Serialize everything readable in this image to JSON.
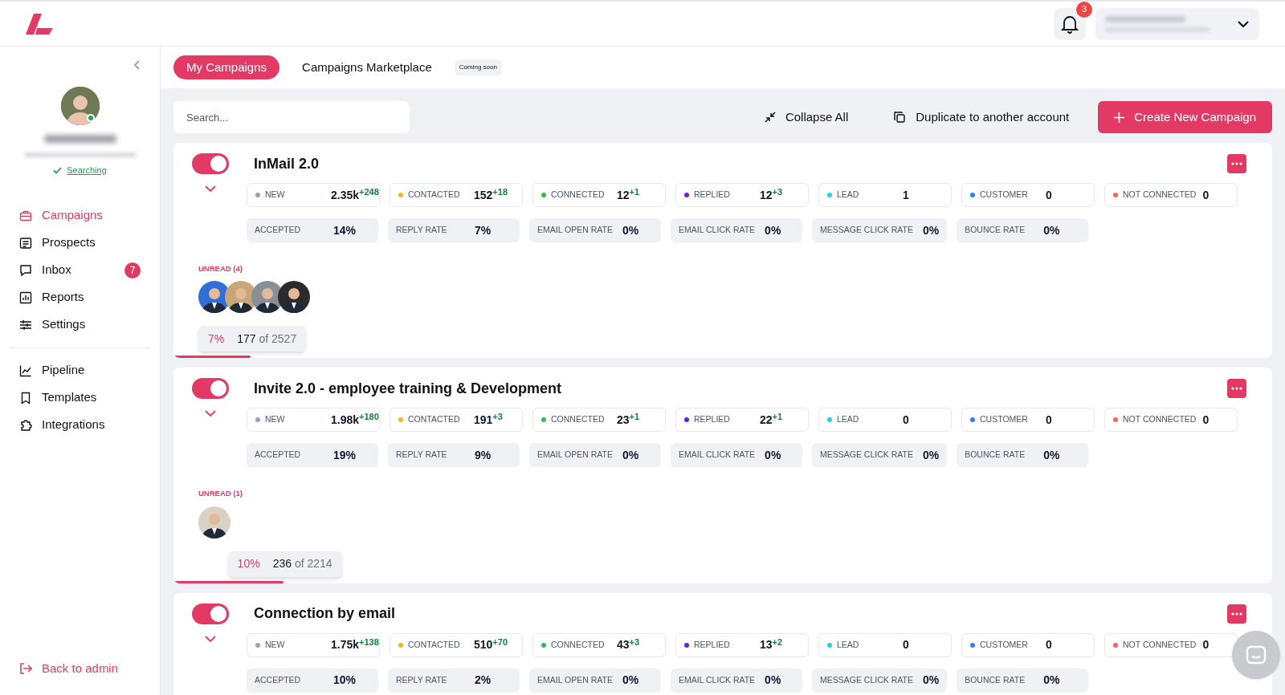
{
  "header": {
    "notifications": {
      "count": "3"
    }
  },
  "sidebar": {
    "status": "Searching",
    "nav": [
      {
        "label": "Campaigns",
        "kind": "briefcase",
        "selected": true
      },
      {
        "label": "Prospects",
        "kind": "list",
        "selected": false
      },
      {
        "label": "Inbox",
        "kind": "chat",
        "selected": false,
        "badge": "7"
      },
      {
        "label": "Reports",
        "kind": "chart",
        "selected": false
      },
      {
        "label": "Settings",
        "kind": "sliders",
        "selected": false
      }
    ],
    "secondary_nav": [
      {
        "label": "Pipeline",
        "kind": "trend",
        "selected": false
      },
      {
        "label": "Templates",
        "kind": "bookmark",
        "selected": false
      },
      {
        "label": "Integrations",
        "kind": "puzzle",
        "selected": false
      }
    ],
    "back_link": "Back to admin"
  },
  "tabs": [
    {
      "label": "My Campaigns",
      "selected": true
    },
    {
      "label": "Campaigns Marketplace",
      "selected": false,
      "badge": "Coming soon"
    }
  ],
  "toolbar": {
    "search": {
      "placeholder": "Search..."
    },
    "collapse": "Collapse All",
    "duplicate": "Duplicate to another account",
    "create": "Create New Campaign"
  },
  "campaigns": [
    {
      "name": "InMail 2.0",
      "on": true,
      "stats": [
        {
          "label": "NEW",
          "color": "#94a3c4",
          "value": "2.35k",
          "delta": "+248"
        },
        {
          "label": "CONTACTED",
          "color": "#f5b521",
          "value": "152",
          "delta": "+18"
        },
        {
          "label": "CONNECTED",
          "color": "#2fbf4f",
          "value": "12",
          "delta": "+1"
        },
        {
          "label": "REPLIED",
          "color": "#6a1cf0",
          "value": "12",
          "delta": "+3"
        },
        {
          "label": "LEAD",
          "color": "#22d3d8",
          "value": "1"
        },
        {
          "label": "CUSTOMER",
          "color": "#2f7ff0",
          "value": "0"
        },
        {
          "label": "NOT CONNECTED",
          "color": "#f4645a",
          "value": "0"
        }
      ],
      "rates": [
        {
          "label": "ACCEPTED",
          "value": "14%"
        },
        {
          "label": "REPLY RATE",
          "value": "7%"
        },
        {
          "label": "EMAIL OPEN RATE",
          "value": "0%"
        },
        {
          "label": "EMAIL CLICK RATE",
          "value": "0%"
        },
        {
          "label": "MESSAGE CLICK RATE",
          "value": "0%"
        },
        {
          "label": "BOUNCE RATE",
          "value": "0%"
        }
      ],
      "unread": {
        "label": "UNREAD (4)"
      },
      "progress": {
        "percent": "7%",
        "done": "177",
        "total": "of 2527",
        "level": 0.07
      }
    },
    {
      "name": "Invite 2.0 - employee training & Development",
      "on": true,
      "stats": [
        {
          "label": "NEW",
          "color": "#94a3c4",
          "value": "1.98k",
          "delta": "+180"
        },
        {
          "label": "CONTACTED",
          "color": "#f5b521",
          "value": "191",
          "delta": "+3"
        },
        {
          "label": "CONNECTED",
          "color": "#2fbf4f",
          "value": "23",
          "delta": "+1"
        },
        {
          "label": "REPLIED",
          "color": "#6a1cf0",
          "value": "22",
          "delta": "+1"
        },
        {
          "label": "LEAD",
          "color": "#22d3d8",
          "value": "0"
        },
        {
          "label": "CUSTOMER",
          "color": "#2f7ff0",
          "value": "0"
        },
        {
          "label": "NOT CONNECTED",
          "color": "#f4645a",
          "value": "0"
        }
      ],
      "rates": [
        {
          "label": "ACCEPTED",
          "value": "19%"
        },
        {
          "label": "REPLY RATE",
          "value": "9%"
        },
        {
          "label": "EMAIL OPEN RATE",
          "value": "0%"
        },
        {
          "label": "EMAIL CLICK RATE",
          "value": "0%"
        },
        {
          "label": "MESSAGE CLICK RATE",
          "value": "0%"
        },
        {
          "label": "BOUNCE RATE",
          "value": "0%"
        }
      ],
      "unread": {
        "label": "UNREAD (1)"
      },
      "progress": {
        "percent": "10%",
        "done": "236",
        "total": "of 2214",
        "level": 0.1
      }
    },
    {
      "name": "Connection by email",
      "on": true,
      "stats": [
        {
          "label": "NEW",
          "color": "#94a3c4",
          "value": "1.75k",
          "delta": "+138"
        },
        {
          "label": "CONTACTED",
          "color": "#f5b521",
          "value": "510",
          "delta": "+70"
        },
        {
          "label": "CONNECTED",
          "color": "#2fbf4f",
          "value": "43",
          "delta": "+3"
        },
        {
          "label": "REPLIED",
          "color": "#6a1cf0",
          "value": "13",
          "delta": "+2"
        },
        {
          "label": "LEAD",
          "color": "#22d3d8",
          "value": "0"
        },
        {
          "label": "CUSTOMER",
          "color": "#2f7ff0",
          "value": "0"
        },
        {
          "label": "NOT CONNECTED",
          "color": "#f4645a",
          "value": "0"
        }
      ],
      "rates": [
        {
          "label": "ACCEPTED",
          "value": "10%"
        },
        {
          "label": "REPLY RATE",
          "value": "2%"
        },
        {
          "label": "EMAIL OPEN RATE",
          "value": "0%"
        },
        {
          "label": "EMAIL CLICK RATE",
          "value": "0%"
        },
        {
          "label": "MESSAGE CLICK RATE",
          "value": "0%"
        },
        {
          "label": "BOUNCE RATE",
          "value": "0%"
        }
      ]
    }
  ]
}
